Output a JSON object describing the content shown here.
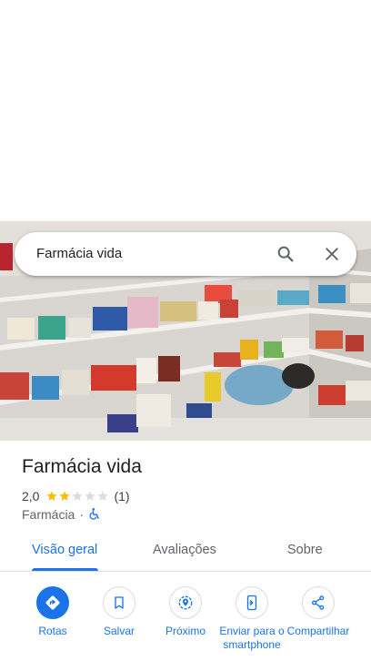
{
  "search": {
    "query": "Farmácia vida",
    "search_icon": "search-icon",
    "close_icon": "close-icon"
  },
  "place": {
    "name": "Farmácia vida",
    "rating": "2,0",
    "rating_value": 2,
    "rating_max": 5,
    "review_count": "(1)",
    "category": "Farmácia",
    "separator": "·",
    "accessibility_icon": "wheelchair-icon"
  },
  "tabs": [
    {
      "label": "Visão geral",
      "active": true
    },
    {
      "label": "Avaliações",
      "active": false
    },
    {
      "label": "Sobre",
      "active": false
    }
  ],
  "actions": [
    {
      "label": "Rotas",
      "icon": "directions-icon"
    },
    {
      "label": "Salvar",
      "icon": "bookmark-icon"
    },
    {
      "label": "Próximo",
      "icon": "nearby-icon"
    },
    {
      "label": "Enviar para o smartphone",
      "icon": "send-to-phone-icon"
    },
    {
      "label": "Compartilhar",
      "icon": "share-icon"
    }
  ],
  "colors": {
    "accent": "#1a73e8",
    "star_filled": "#fbbc04",
    "star_empty": "#dadce0"
  }
}
